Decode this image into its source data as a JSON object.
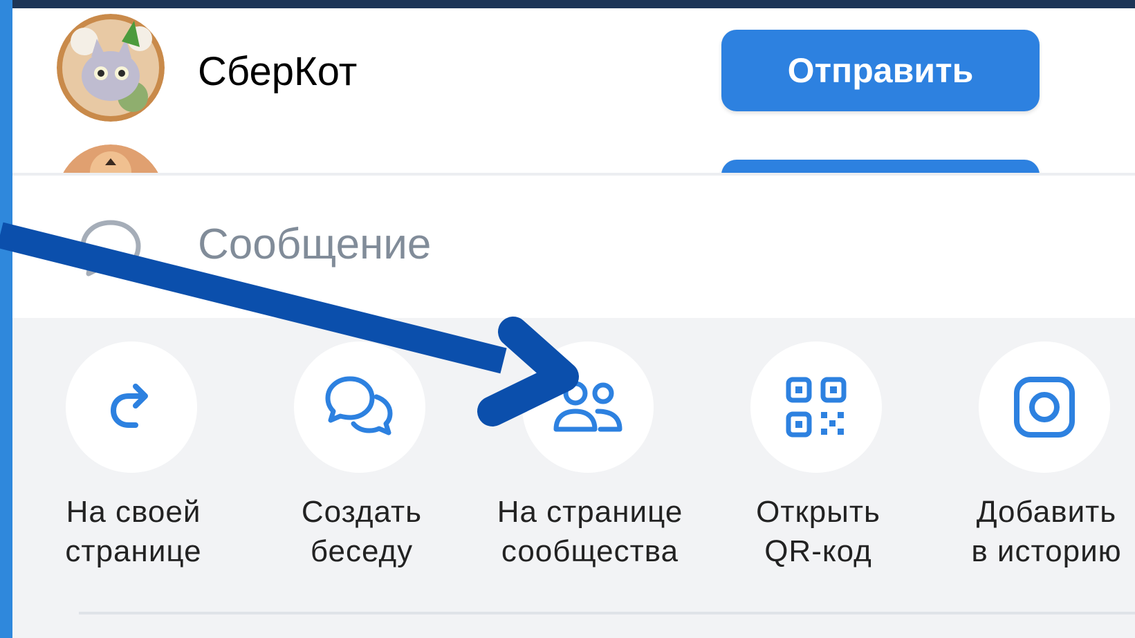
{
  "contacts": [
    {
      "name": "СберКот",
      "send_label": "Отправить"
    },
    {
      "name": "",
      "send_label": ""
    }
  ],
  "message": {
    "placeholder": "Сообщение"
  },
  "share_options": [
    {
      "icon": "repost-icon",
      "line1": "На своей",
      "line2": "странице"
    },
    {
      "icon": "chats-icon",
      "line1": "Создать",
      "line2": "беседу"
    },
    {
      "icon": "users-icon",
      "line1": "На странице",
      "line2": "сообщества"
    },
    {
      "icon": "qr-code-icon",
      "line1": "Открыть",
      "line2": "QR-код"
    },
    {
      "icon": "instagram-story-icon",
      "line1": "Добавить",
      "line2": "в историю"
    }
  ],
  "colors": {
    "accent": "#2d81e0",
    "icon_blue": "#2d81e0",
    "annotation_arrow": "#0b4fac",
    "panel_bg": "#f2f3f5",
    "placeholder": "#818c99"
  }
}
